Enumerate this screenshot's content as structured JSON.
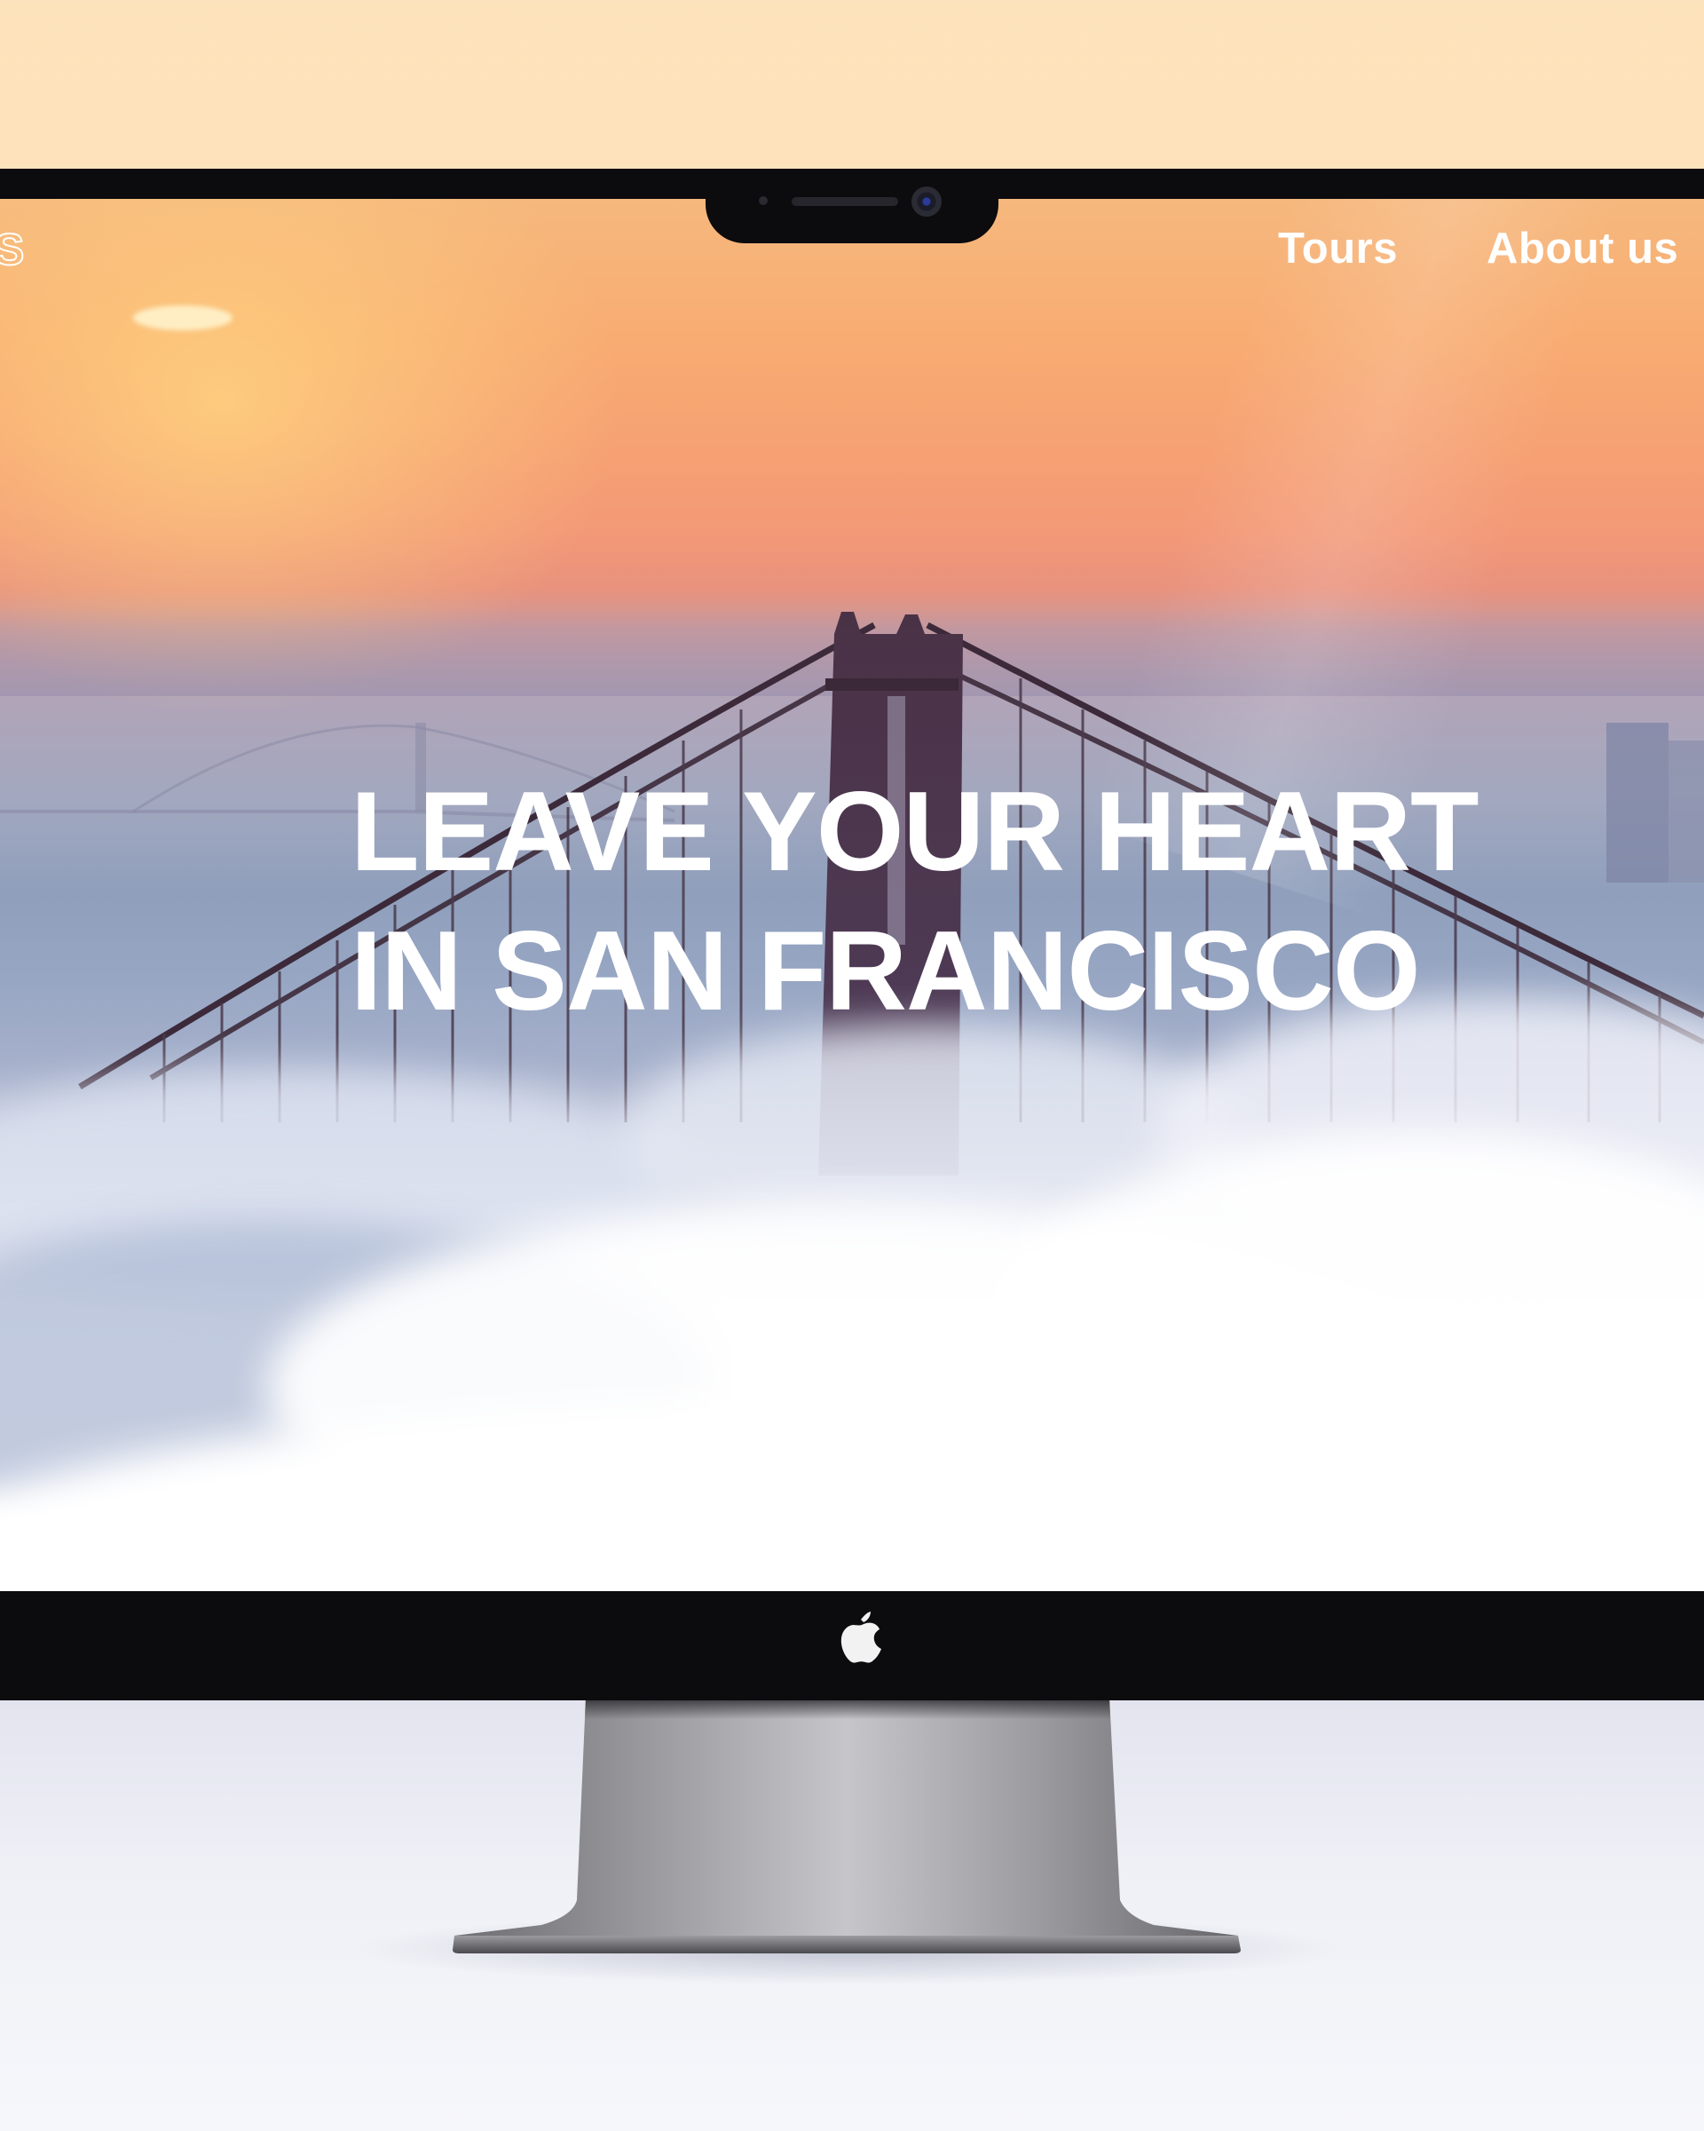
{
  "website": {
    "brand_fragment": "S",
    "nav": {
      "items": [
        {
          "label": "Tours"
        },
        {
          "label": "About us"
        }
      ]
    },
    "hero": {
      "title_line_1": "LEAVE YOUR HEART",
      "title_line_2": "IN SAN FRANCISCO"
    }
  },
  "device": {
    "logo_icon": "apple-logo-icon",
    "camera_icon": "webcam-icon"
  },
  "colors": {
    "sky_top": "#f8ac72",
    "fog": "#ffffff",
    "bezel": "#0c0b0e",
    "text": "#ffffff"
  }
}
